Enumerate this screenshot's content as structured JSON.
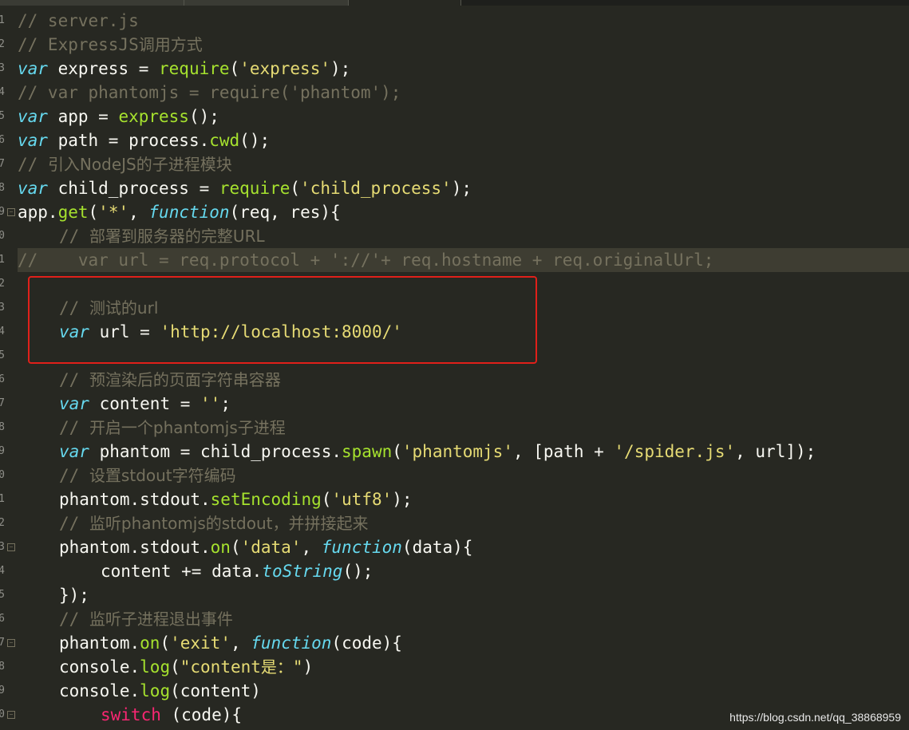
{
  "editor": {
    "line_numbers": [
      "1",
      "2",
      "3",
      "4",
      "5",
      "6",
      "7",
      "8",
      "9",
      "0",
      "1",
      "2",
      "3",
      "4",
      "5",
      "6",
      "7",
      "8",
      "9",
      "0",
      "1",
      "2",
      "3",
      "4",
      "5",
      "6",
      "7",
      "8",
      "9",
      "0"
    ],
    "lines": [
      {
        "i": 0,
        "seg": [
          {
            "c": "cm",
            "t": "// server.js"
          }
        ]
      },
      {
        "i": 0,
        "seg": [
          {
            "c": "cm",
            "t": "// ExpressJS"
          },
          {
            "c": "cm cn",
            "t": "调用方式"
          }
        ]
      },
      {
        "i": 0,
        "seg": [
          {
            "c": "kw",
            "t": "var"
          },
          {
            "c": "",
            "t": " express = "
          },
          {
            "c": "fn",
            "t": "require"
          },
          {
            "c": "",
            "t": "("
          },
          {
            "c": "str",
            "t": "'express'"
          },
          {
            "c": "",
            "t": ");"
          }
        ]
      },
      {
        "i": 0,
        "seg": [
          {
            "c": "cm",
            "t": "// var phantomjs = require('phantom');"
          }
        ]
      },
      {
        "i": 0,
        "seg": [
          {
            "c": "kw",
            "t": "var"
          },
          {
            "c": "",
            "t": " app = "
          },
          {
            "c": "fn",
            "t": "express"
          },
          {
            "c": "",
            "t": "();"
          }
        ]
      },
      {
        "i": 0,
        "seg": [
          {
            "c": "kw",
            "t": "var"
          },
          {
            "c": "",
            "t": " path = process."
          },
          {
            "c": "fn",
            "t": "cwd"
          },
          {
            "c": "",
            "t": "();"
          }
        ]
      },
      {
        "i": 0,
        "seg": [
          {
            "c": "cm",
            "t": "// "
          },
          {
            "c": "cm cn",
            "t": "引入NodeJS的子进程模块"
          }
        ]
      },
      {
        "i": 0,
        "seg": [
          {
            "c": "kw",
            "t": "var"
          },
          {
            "c": "",
            "t": " child_process = "
          },
          {
            "c": "fn",
            "t": "require"
          },
          {
            "c": "",
            "t": "("
          },
          {
            "c": "str",
            "t": "'child_process'"
          },
          {
            "c": "",
            "t": ");"
          }
        ]
      },
      {
        "i": 0,
        "seg": [
          {
            "c": "",
            "t": "app."
          },
          {
            "c": "fn",
            "t": "get"
          },
          {
            "c": "",
            "t": "("
          },
          {
            "c": "str",
            "t": "'*'"
          },
          {
            "c": "",
            "t": ", "
          },
          {
            "c": "kw",
            "t": "function"
          },
          {
            "c": "",
            "t": "(req, res){"
          }
        ]
      },
      {
        "i": 1,
        "seg": [
          {
            "c": "cm",
            "t": "// "
          },
          {
            "c": "cm cn",
            "t": "部署到服务器的完整URL"
          }
        ]
      },
      {
        "i": 0,
        "hl": true,
        "seg": [
          {
            "c": "cm",
            "t": "//    var url = req.protocol + '://'+ req.hostname + req.originalUrl;"
          }
        ]
      },
      {
        "i": 0,
        "seg": []
      },
      {
        "i": 1,
        "seg": [
          {
            "c": "cm",
            "t": "// "
          },
          {
            "c": "cm cn",
            "t": "测试的url"
          }
        ]
      },
      {
        "i": 1,
        "seg": [
          {
            "c": "kw",
            "t": "var"
          },
          {
            "c": "",
            "t": " url = "
          },
          {
            "c": "str",
            "t": "'http://localhost:8000/'"
          }
        ]
      },
      {
        "i": 0,
        "seg": []
      },
      {
        "i": 1,
        "seg": [
          {
            "c": "cm",
            "t": "// "
          },
          {
            "c": "cm cn",
            "t": "预渲染后的页面字符串容器"
          }
        ]
      },
      {
        "i": 1,
        "seg": [
          {
            "c": "kw",
            "t": "var"
          },
          {
            "c": "",
            "t": " content = "
          },
          {
            "c": "str",
            "t": "''"
          },
          {
            "c": "",
            "t": ";"
          }
        ]
      },
      {
        "i": 1,
        "seg": [
          {
            "c": "cm",
            "t": "// "
          },
          {
            "c": "cm cn",
            "t": "开启一个phantomjs子进程"
          }
        ]
      },
      {
        "i": 1,
        "seg": [
          {
            "c": "kw",
            "t": "var"
          },
          {
            "c": "",
            "t": " phantom = child_process."
          },
          {
            "c": "fn",
            "t": "spawn"
          },
          {
            "c": "",
            "t": "("
          },
          {
            "c": "str",
            "t": "'phantomjs'"
          },
          {
            "c": "",
            "t": ", [path + "
          },
          {
            "c": "str",
            "t": "'/spider.js'"
          },
          {
            "c": "",
            "t": ", url]);"
          }
        ]
      },
      {
        "i": 1,
        "seg": [
          {
            "c": "cm",
            "t": "// "
          },
          {
            "c": "cm cn",
            "t": "设置stdout字符编码"
          }
        ]
      },
      {
        "i": 1,
        "seg": [
          {
            "c": "",
            "t": "phantom.stdout."
          },
          {
            "c": "fn",
            "t": "setEncoding"
          },
          {
            "c": "",
            "t": "("
          },
          {
            "c": "str",
            "t": "'utf8'"
          },
          {
            "c": "",
            "t": ");"
          }
        ]
      },
      {
        "i": 1,
        "seg": [
          {
            "c": "cm",
            "t": "// "
          },
          {
            "c": "cm cn",
            "t": "监听phantomjs的stdout，并拼接起来"
          }
        ]
      },
      {
        "i": 1,
        "seg": [
          {
            "c": "",
            "t": "phantom.stdout."
          },
          {
            "c": "fn",
            "t": "on"
          },
          {
            "c": "",
            "t": "("
          },
          {
            "c": "str",
            "t": "'data'"
          },
          {
            "c": "",
            "t": ", "
          },
          {
            "c": "kw",
            "t": "function"
          },
          {
            "c": "",
            "t": "(data){"
          }
        ]
      },
      {
        "i": 2,
        "seg": [
          {
            "c": "",
            "t": "content += data."
          },
          {
            "c": "kw",
            "t": "toString"
          },
          {
            "c": "",
            "t": "();"
          }
        ]
      },
      {
        "i": 1,
        "seg": [
          {
            "c": "",
            "t": "});"
          }
        ]
      },
      {
        "i": 1,
        "seg": [
          {
            "c": "cm",
            "t": "// "
          },
          {
            "c": "cm cn",
            "t": "监听子进程退出事件"
          }
        ]
      },
      {
        "i": 1,
        "seg": [
          {
            "c": "",
            "t": "phantom."
          },
          {
            "c": "fn",
            "t": "on"
          },
          {
            "c": "",
            "t": "("
          },
          {
            "c": "str",
            "t": "'exit'"
          },
          {
            "c": "",
            "t": ", "
          },
          {
            "c": "kw",
            "t": "function"
          },
          {
            "c": "",
            "t": "(code){"
          }
        ]
      },
      {
        "i": 1,
        "seg": [
          {
            "c": "",
            "t": "console."
          },
          {
            "c": "fn",
            "t": "log"
          },
          {
            "c": "",
            "t": "("
          },
          {
            "c": "str",
            "t": "\"content"
          },
          {
            "c": "str cn",
            "t": "是："
          },
          {
            "c": "str",
            "t": "\""
          },
          {
            "c": "",
            "t": ")"
          }
        ]
      },
      {
        "i": 1,
        "seg": [
          {
            "c": "",
            "t": "console."
          },
          {
            "c": "fn",
            "t": "log"
          },
          {
            "c": "",
            "t": "(content)"
          }
        ]
      },
      {
        "i": 2,
        "seg": [
          {
            "c": "pink",
            "t": "switch"
          },
          {
            "c": "",
            "t": " (code){"
          }
        ]
      }
    ]
  },
  "watermark": "https://blog.csdn.net/qq_38868959"
}
